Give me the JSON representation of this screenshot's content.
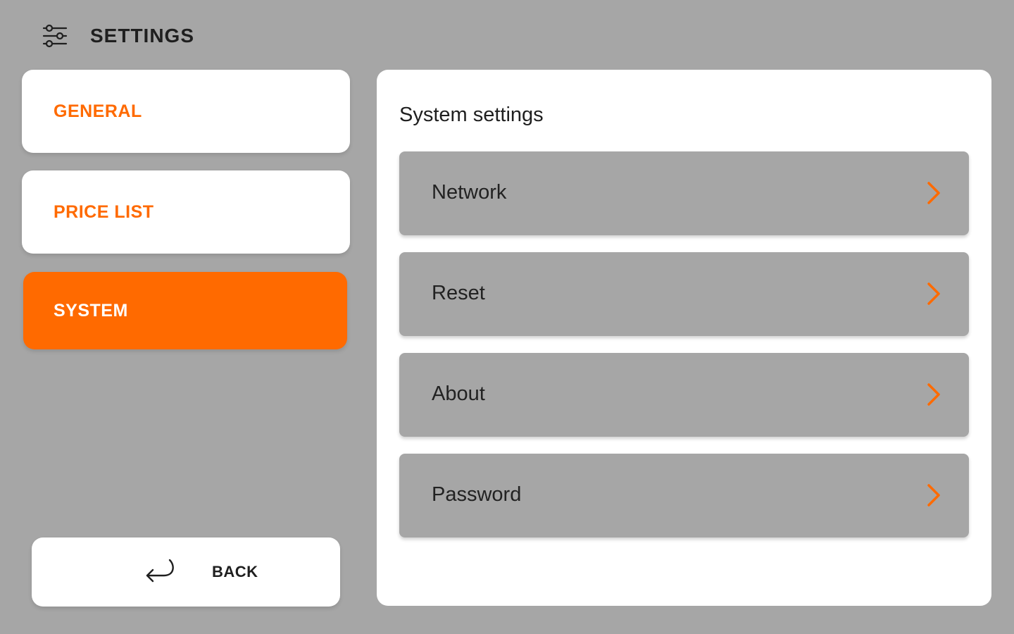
{
  "header": {
    "title": "SETTINGS",
    "icon": "settings-sliders-icon"
  },
  "nav": {
    "items": [
      {
        "label": "GENERAL",
        "active": false
      },
      {
        "label": "PRICE LIST",
        "active": false
      },
      {
        "label": "SYSTEM",
        "active": true
      }
    ],
    "back_label": "BACK",
    "back_icon": "return-arrow-icon"
  },
  "panel": {
    "title": "System settings",
    "rows": [
      {
        "label": "Network",
        "icon": "chevron-right-icon"
      },
      {
        "label": "Reset",
        "icon": "chevron-right-icon"
      },
      {
        "label": "About",
        "icon": "chevron-right-icon"
      },
      {
        "label": "Password",
        "icon": "chevron-right-icon"
      }
    ]
  },
  "colors": {
    "background": "#a6a6a6",
    "accent": "#ff6a00",
    "card": "#ffffff",
    "text": "#1f1f1f"
  }
}
